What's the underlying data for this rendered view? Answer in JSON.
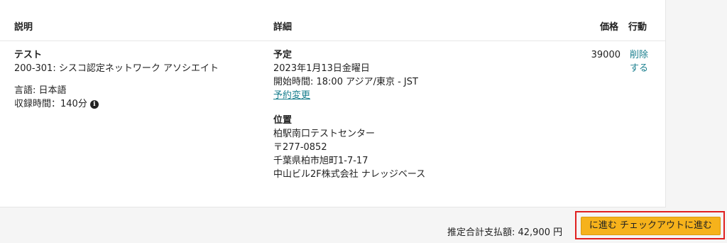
{
  "table": {
    "headers": {
      "description": "説明",
      "detail": "詳細",
      "price": "価格",
      "action": "行動"
    },
    "item": {
      "type": "テスト",
      "exam": "200-301: シスコ認定ネットワーク アソシエイト",
      "language": "言語: 日本語",
      "duration": "収録時間：140分",
      "info_icon": "info-icon",
      "schedule_title": "予定",
      "date": "2023年1月13日金曜日",
      "start_time": "開始時間: 18:00 アジア/東京 - JST",
      "reschedule_link": "予約変更",
      "location_title": "位置",
      "location_lines": [
        "柏駅南口テストセンター",
        "〒277-0852",
        "千葉県柏市旭町1-7-17",
        "中山ビル2F株式会社 ナレッジベース"
      ],
      "price": "39000",
      "remove_label": "削除\nする"
    }
  },
  "footer": {
    "total": "推定合計支払額: 42,900 円",
    "checkout_label": "に進む チェックアウトに進む"
  },
  "colors": {
    "link": "#1a7f8e",
    "button": "#f6b21b",
    "highlight": "#e02020"
  }
}
